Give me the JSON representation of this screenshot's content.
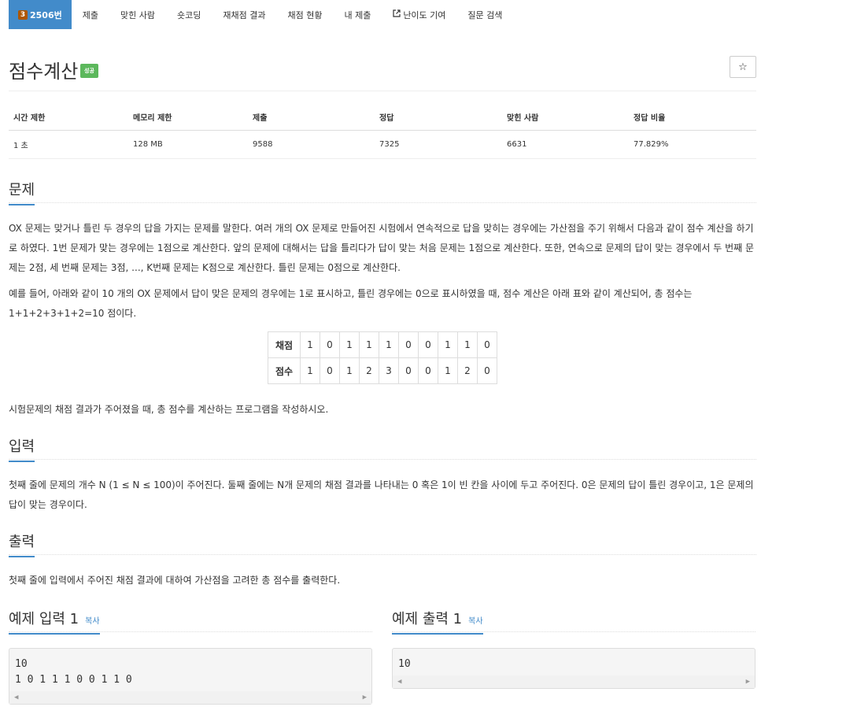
{
  "nav": {
    "problem_tab": "2506번",
    "tier_badge": "3",
    "tabs": [
      "제출",
      "맞힌 사람",
      "숏코딩",
      "재채점 결과",
      "채점 현황",
      "내 제출",
      "난이도 기여",
      "질문 검색"
    ]
  },
  "title": "점수계산",
  "result_badge": "성공",
  "star": "☆",
  "info": {
    "headers": [
      "시간 제한",
      "메모리 제한",
      "제출",
      "정답",
      "맞힌 사람",
      "정답 비율"
    ],
    "values": [
      "1 초",
      "128 MB",
      "9588",
      "7325",
      "6631",
      "77.829%"
    ]
  },
  "problem": {
    "heading": "문제",
    "p1": "OX 문제는 맞거나 틀린 두 경우의 답을 가지는 문제를 말한다. 여러 개의 OX 문제로 만들어진 시험에서 연속적으로 답을 맞히는 경우에는 가산점을 주기 위해서 다음과 같이 점수 계산을 하기로 하였다. 1번 문제가 맞는 경우에는 1점으로 계산한다. 앞의 문제에 대해서는 답을 틀리다가 답이 맞는 처음 문제는 1점으로 계산한다. 또한, 연속으로 문제의 답이 맞는 경우에서 두 번째 문제는 2점, 세 번째 문제는 3점, ..., K번째 문제는 K점으로 계산한다. 틀린 문제는 0점으로 계산한다.",
    "p2": "예를 들어, 아래와 같이 10 개의 OX 문제에서 답이 맞은 문제의 경우에는 1로 표시하고, 틀린 경우에는 0으로 표시하였을 때, 점수 계산은 아래 표와 같이 계산되어, 총 점수는 1+1+2+3+1+2=10 점이다.",
    "table": {
      "row1_label": "채점",
      "row1": [
        "1",
        "0",
        "1",
        "1",
        "1",
        "0",
        "0",
        "1",
        "1",
        "0"
      ],
      "row2_label": "점수",
      "row2": [
        "1",
        "0",
        "1",
        "2",
        "3",
        "0",
        "0",
        "1",
        "2",
        "0"
      ]
    },
    "p3": "시험문제의 채점 결과가 주어졌을 때, 총 점수를 계산하는 프로그램을 작성하시오."
  },
  "input": {
    "heading": "입력",
    "text": "첫째 줄에 문제의 개수 N (1 ≤ N ≤ 100)이 주어진다. 둘째 줄에는 N개 문제의 채점 결과를 나타내는 0 혹은 1이 빈 칸을 사이에 두고 주어진다. 0은 문제의 답이 틀린 경우이고, 1은 문제의 답이 맞는 경우이다."
  },
  "output": {
    "heading": "출력",
    "text": "첫째 줄에 입력에서 주어진 채점 결과에 대하여 가산점을 고려한 총 점수를 출력한다."
  },
  "sample_input": {
    "heading": "예제 입력 1",
    "copy": "복사",
    "line1": "10",
    "line2": "1 0 1 1 1 0 0 1 1 0"
  },
  "sample_output": {
    "heading": "예제 출력 1",
    "copy": "복사",
    "line1": "10"
  },
  "scroll": {
    "left": "◀",
    "right": "▶"
  }
}
